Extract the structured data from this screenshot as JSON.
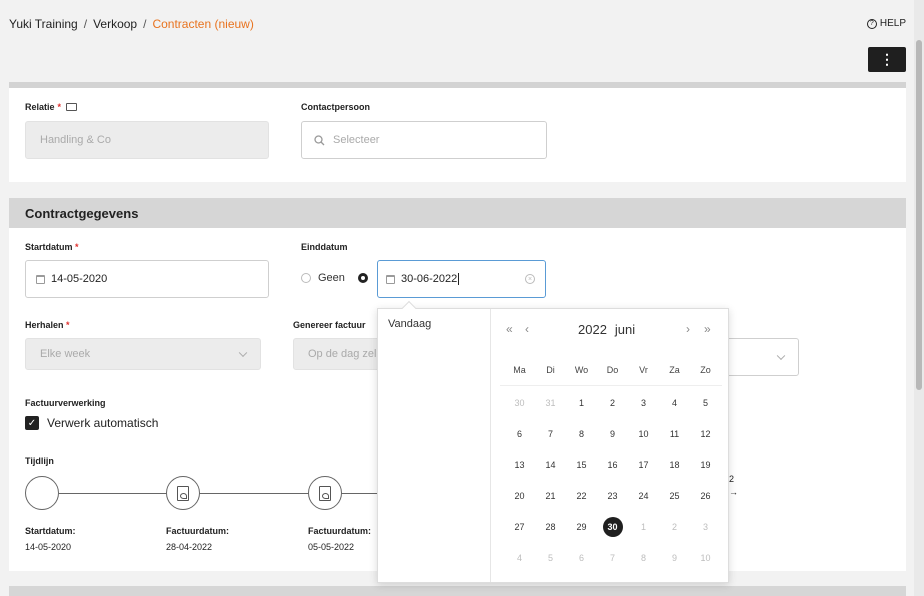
{
  "breadcrumb": {
    "items": [
      "Yuki Training",
      "Verkoop"
    ],
    "current": "Contracten (nieuw)",
    "separator": "/"
  },
  "header": {
    "help_label": "HELP",
    "help_icon": "question-circle-icon",
    "menu_icon": "kebab-menu-icon"
  },
  "relatie": {
    "label": "Relatie",
    "required_mark": "*",
    "icon": "contact-card-icon",
    "value": "Handling & Co"
  },
  "contactpersoon": {
    "label": "Contactpersoon",
    "placeholder": "Selecteer",
    "icon": "search-icon"
  },
  "contract": {
    "section_title": "Contractgegevens",
    "startdatum_label": "Startdatum",
    "startdatum_value": "14-05-2020",
    "einddatum_label": "Einddatum",
    "geen_label": "Geen",
    "einddatum_value": "30-06-2022",
    "herhalen_label": "Herhalen",
    "herhalen_value": "Elke week",
    "genereer_label": "Genereer factuur",
    "genereer_value": "Op de dag zel",
    "factuurverwerking_label": "Factuurverwerking",
    "verwerk_label": "Verwerk automatisch",
    "verwerk_checked": true,
    "required_mark": "*"
  },
  "timeline": {
    "label": "Tijdlijn",
    "items": [
      {
        "title": "Startdatum:",
        "date": "14-05-2020"
      },
      {
        "title": "Factuurdatum:",
        "date": "28-04-2022"
      },
      {
        "title": "Factuurdatum:",
        "date": "05-05-2022"
      }
    ],
    "partial_text": "2"
  },
  "datepicker": {
    "today_label": "Vandaag",
    "year": "2022",
    "month": "juni",
    "nav_prev_year": "«",
    "nav_prev_month": "‹",
    "nav_next_month": "›",
    "nav_next_year": "»",
    "weekdays": [
      "Ma",
      "Di",
      "Wo",
      "Do",
      "Vr",
      "Za",
      "Zo"
    ],
    "weeks": [
      [
        {
          "d": "30",
          "m": true
        },
        {
          "d": "31",
          "m": true
        },
        {
          "d": "1"
        },
        {
          "d": "2"
        },
        {
          "d": "3"
        },
        {
          "d": "4"
        },
        {
          "d": "5"
        }
      ],
      [
        {
          "d": "6"
        },
        {
          "d": "7"
        },
        {
          "d": "8"
        },
        {
          "d": "9"
        },
        {
          "d": "10"
        },
        {
          "d": "11"
        },
        {
          "d": "12"
        }
      ],
      [
        {
          "d": "13"
        },
        {
          "d": "14"
        },
        {
          "d": "15"
        },
        {
          "d": "16"
        },
        {
          "d": "17"
        },
        {
          "d": "18"
        },
        {
          "d": "19"
        }
      ],
      [
        {
          "d": "20"
        },
        {
          "d": "21"
        },
        {
          "d": "22"
        },
        {
          "d": "23"
        },
        {
          "d": "24"
        },
        {
          "d": "25"
        },
        {
          "d": "26"
        }
      ],
      [
        {
          "d": "27"
        },
        {
          "d": "28"
        },
        {
          "d": "29"
        },
        {
          "d": "30",
          "sel": true
        },
        {
          "d": "1",
          "m": true
        },
        {
          "d": "2",
          "m": true
        },
        {
          "d": "3",
          "m": true
        }
      ],
      [
        {
          "d": "4",
          "m": true
        },
        {
          "d": "5",
          "m": true
        },
        {
          "d": "6",
          "m": true
        },
        {
          "d": "7",
          "m": true
        },
        {
          "d": "8",
          "m": true
        },
        {
          "d": "9",
          "m": true
        },
        {
          "d": "10",
          "m": true
        }
      ]
    ]
  }
}
